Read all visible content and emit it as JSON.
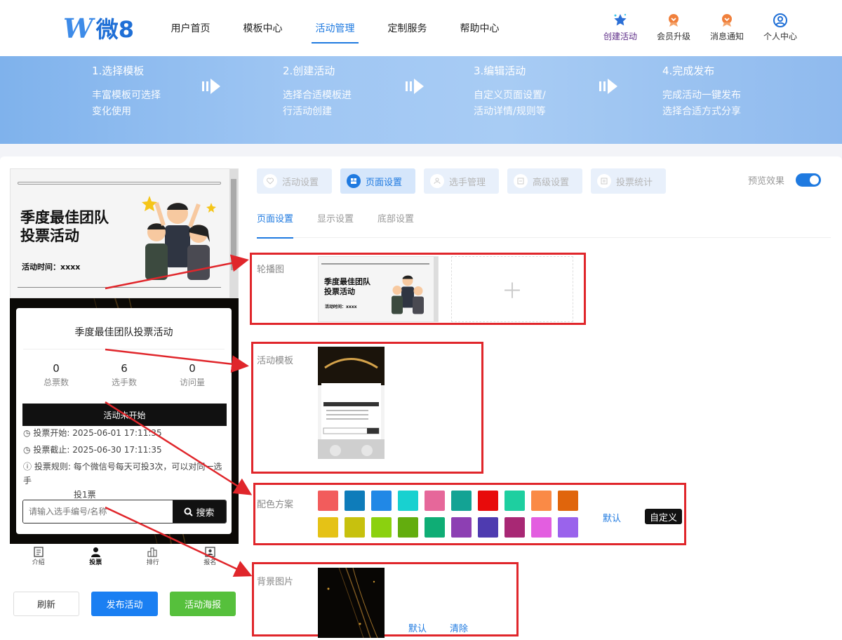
{
  "header": {
    "logo_mark": "W",
    "logo_text": "微8",
    "nav": [
      "用户首页",
      "模板中心",
      "活动管理",
      "定制服务",
      "帮助中心"
    ],
    "actions": [
      {
        "label": "创建活动",
        "icon": "star-icon"
      },
      {
        "label": "会员升级",
        "icon": "member-badge-icon"
      },
      {
        "label": "消息通知",
        "icon": "notification-icon"
      },
      {
        "label": "个人中心",
        "icon": "user-icon"
      }
    ]
  },
  "steps": [
    {
      "title": "1.选择模板",
      "desc1": "丰富模板可选择",
      "desc2": "变化使用"
    },
    {
      "title": "2.创建活动",
      "desc1": "选择合适模板进",
      "desc2": "行活动创建"
    },
    {
      "title": "3.编辑活动",
      "desc1": "自定义页面设置/",
      "desc2": "活动详情/规则等"
    },
    {
      "title": "4.完成发布",
      "desc1": "完成活动一键发布",
      "desc2": "选择合适方式分享"
    }
  ],
  "preview": {
    "banner_title_1": "季度最佳团队",
    "banner_title_2": "投票活动",
    "banner_time": "活动时间：xxxx",
    "card_title": "季度最佳团队投票活动",
    "stats": [
      {
        "value": "0",
        "label": "总票数"
      },
      {
        "value": "6",
        "label": "选手数"
      },
      {
        "value": "0",
        "label": "访问量"
      }
    ],
    "status": "活动未开始",
    "start_label": "投票开始:",
    "start_value": "2025-06-01 17:11:35",
    "end_label": "投票截止:",
    "end_value": "2025-06-30 17:11:35",
    "rule_label": "投票规则:",
    "rule_value_1": "每个微信号每天可投3次，可以对同一选手",
    "rule_value_2": "投1票",
    "search_placeholder": "请输入选手编号/名称",
    "search_button": "搜索",
    "tabbar": [
      "介绍",
      "投票",
      "排行",
      "报名"
    ]
  },
  "bottom_buttons": {
    "refresh": "刷新",
    "publish": "发布活动",
    "poster": "活动海报"
  },
  "tabs": [
    "活动设置",
    "页面设置",
    "选手管理",
    "高级设置",
    "投票统计"
  ],
  "preview_toggle_label": "预览效果",
  "subtabs": [
    "页面设置",
    "显示设置",
    "底部设置"
  ],
  "sections": {
    "carousel": "轮播图",
    "template": "活动模板",
    "color": "配色方案",
    "background": "背景图片"
  },
  "carousel_thumb": {
    "title_1": "季度最佳团队",
    "title_2": "投票活动",
    "time": "活动时间：xxxx"
  },
  "color_actions": {
    "default": "默认",
    "custom": "自定义"
  },
  "background_actions": {
    "default": "默认",
    "clear": "清除"
  },
  "colors": [
    "#f25c5c",
    "#0e7cba",
    "#2188e6",
    "#18d1d0",
    "#e6679a",
    "#13a394",
    "#e80b0b",
    "#1ecfa0",
    "#fa8a46",
    "#e0650c",
    "#e5c216",
    "#c7c10e",
    "#8bd10f",
    "#63ad0e",
    "#0fad75",
    "#8d3fb3",
    "#4e3bb0",
    "#a82874",
    "#e35ee0",
    "#9a63ec"
  ],
  "accent": "#1f7ae0"
}
